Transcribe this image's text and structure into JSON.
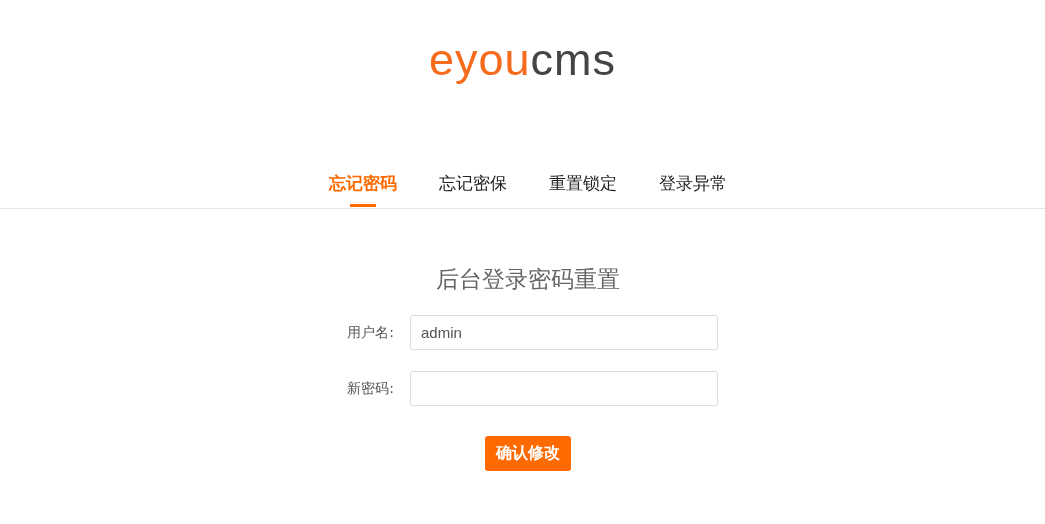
{
  "logo": {
    "accent": "eyou",
    "rest": "cms"
  },
  "tabs": [
    {
      "label": "忘记密码",
      "selected": true
    },
    {
      "label": "忘记密保",
      "selected": false
    },
    {
      "label": "重置锁定",
      "selected": false
    },
    {
      "label": "登录异常",
      "selected": false
    }
  ],
  "form": {
    "title": "后台登录密码重置",
    "fields": [
      {
        "label": "用户名:",
        "value": "admin"
      },
      {
        "label": "新密码:"
      }
    ],
    "submit": "确认修改"
  }
}
